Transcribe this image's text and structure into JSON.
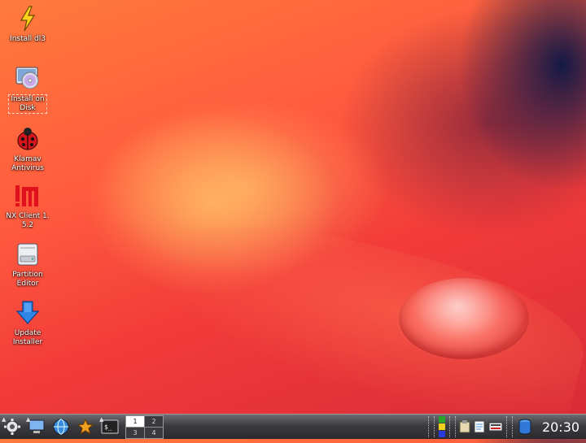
{
  "desktop": {
    "icons": [
      {
        "label": "Install dl3",
        "icon": "lightning-icon"
      },
      {
        "label": "Install on\nDisk",
        "icon": "disk-install-icon"
      },
      {
        "label": "Klamav\nAntivirus",
        "icon": "ladybug-icon"
      },
      {
        "label": "NX Client 1.\n5.2",
        "icon": "nx-client-icon"
      },
      {
        "label": "Partition\nEditor",
        "icon": "drive-icon"
      },
      {
        "label": "Update\nInstaller",
        "icon": "down-arrow-icon"
      }
    ]
  },
  "taskbar": {
    "pager": [
      "1",
      "2",
      "3",
      "4"
    ],
    "clock": "20:30"
  }
}
